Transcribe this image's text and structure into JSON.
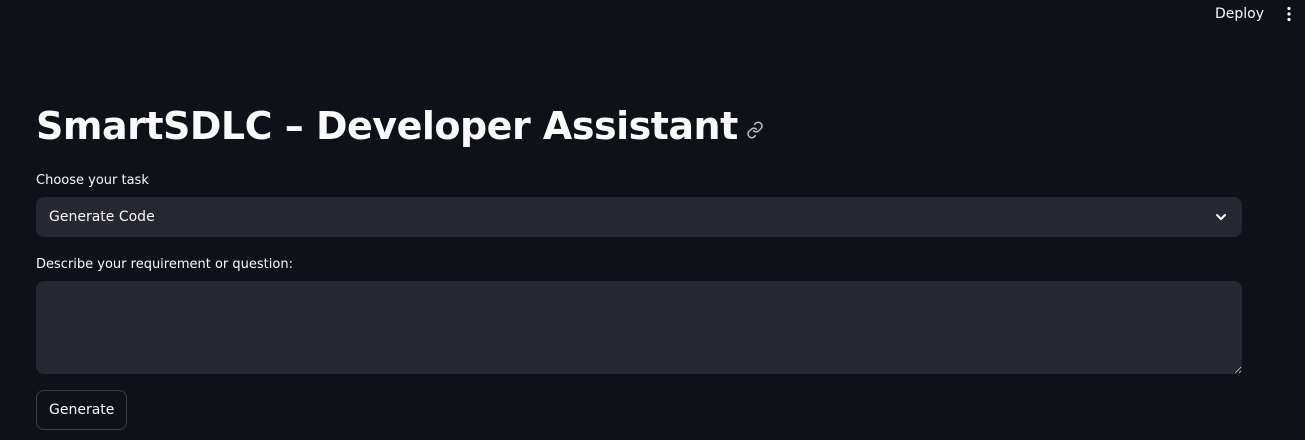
{
  "header": {
    "deploy_label": "Deploy",
    "menu_icon": "kebab-menu-icon"
  },
  "page": {
    "title": "SmartSDLC – Developer Assistant",
    "anchor_icon": "link-icon"
  },
  "task_select": {
    "label": "Choose your task",
    "selected_value": "Generate Code",
    "chevron_icon": "chevron-down-icon"
  },
  "requirement": {
    "label": "Describe your requirement or question:",
    "value": "",
    "placeholder": ""
  },
  "generate_button": {
    "label": "Generate"
  },
  "colors": {
    "background": "#0e1117",
    "input_bg": "#262730",
    "text": "#fafafa",
    "button_border": "#3b3d48"
  }
}
